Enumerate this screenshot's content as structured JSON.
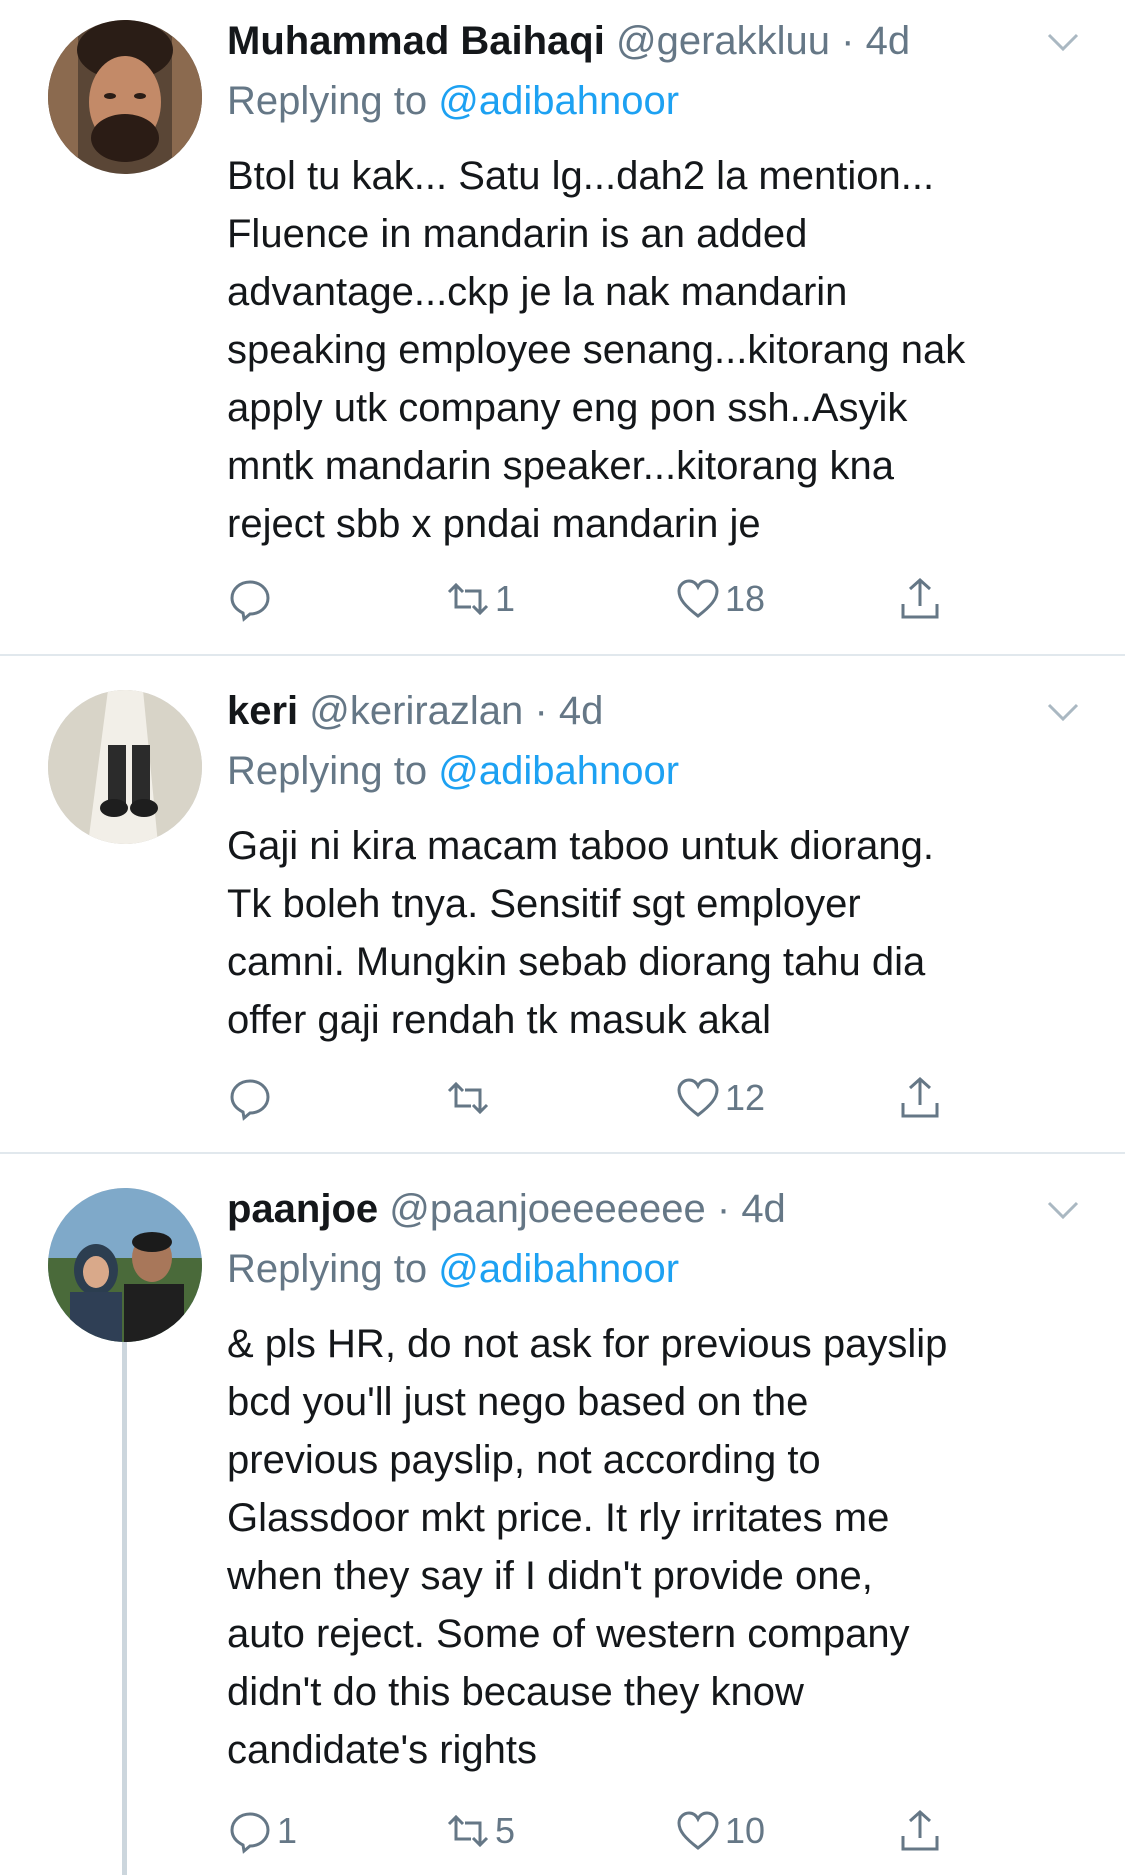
{
  "tweets": [
    {
      "name": "Muhammad Baihaqi",
      "handle": "@gerakkluu",
      "dot": "·",
      "time": "4d",
      "replying_label": "Replying to",
      "replying_to": "@adibahnoor",
      "lines": [
        "Btol tu kak... Satu lg...dah2 la mention...",
        "Fluence in mandarin is an added",
        "advantage...ckp je la nak mandarin",
        "speaking employee senang...kitorang nak",
        "apply utk company eng pon ssh..Asyik",
        "mntk mandarin speaker...kitorang kna",
        "reject sbb x pndai mandarin je"
      ],
      "replies": "",
      "retweets": "1",
      "likes": "18"
    },
    {
      "name": "keri",
      "handle": "@kerirazlan",
      "dot": "·",
      "time": "4d",
      "replying_label": "Replying to",
      "replying_to": "@adibahnoor",
      "lines": [
        "Gaji ni kira macam taboo untuk diorang.",
        "Tk boleh tnya. Sensitif sgt employer",
        "camni. Mungkin sebab diorang tahu dia",
        "offer gaji rendah tk masuk akal"
      ],
      "replies": "",
      "retweets": "",
      "likes": "12"
    },
    {
      "name": "paanjoe",
      "handle": "@paanjoeeeeeee",
      "dot": "·",
      "time": "4d",
      "replying_label": "Replying to",
      "replying_to": "@adibahnoor",
      "lines": [
        "& pls HR, do not ask for previous payslip",
        "bcd you'll just nego based on the",
        "previous payslip, not according to",
        "Glassdoor mkt price. It rly irritates me",
        "when they say if I didn't provide one,",
        "auto reject. Some of western company",
        "didn't do this because they know",
        "candidate's rights"
      ],
      "replies": "1",
      "retweets": "5",
      "likes": "10"
    }
  ],
  "icons": {
    "reply": "reply-icon",
    "retweet": "retweet-icon",
    "like": "heart-icon",
    "share": "share-icon",
    "menu": "chevron-down-icon"
  },
  "colors": {
    "link": "#1da1f2",
    "secondary_text": "#657786",
    "separator": "#e1e8ed",
    "thread_line": "#ccd6dd"
  }
}
